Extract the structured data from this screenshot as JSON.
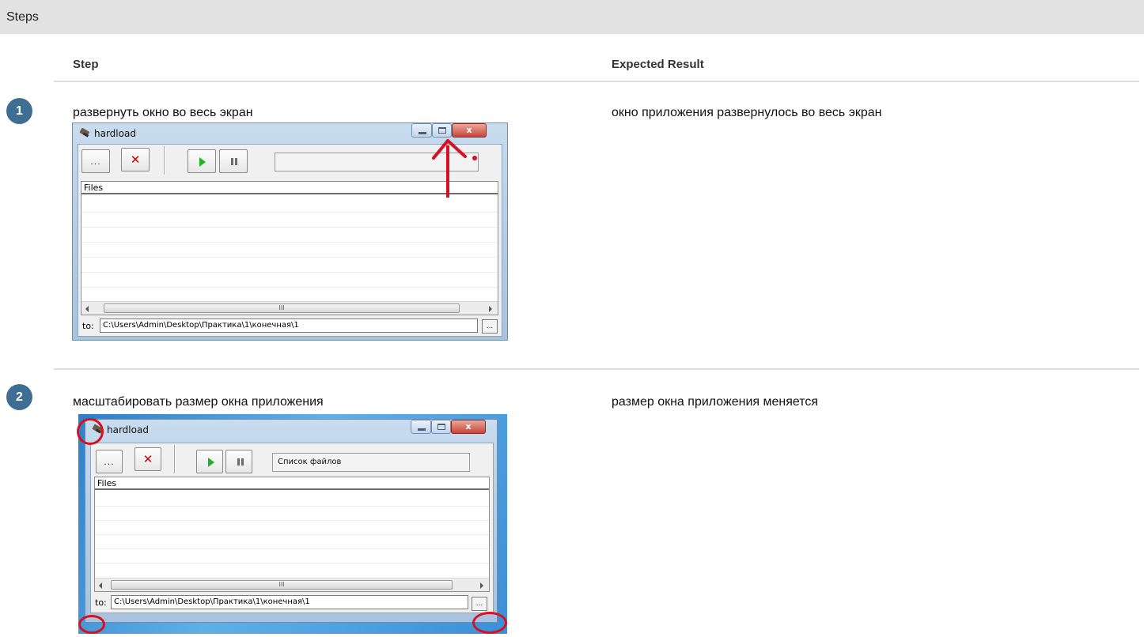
{
  "section": {
    "title": "Steps"
  },
  "columns": {
    "step": "Step",
    "expected": "Expected Result"
  },
  "steps": [
    {
      "number": "1",
      "action": "развернуть окно во весь экран",
      "expected": "окно приложения развернулось во весь экран",
      "window": {
        "title": "hardload",
        "browse_label": "...",
        "cancel_glyph": "✕",
        "close_glyph": "x",
        "status_text": "",
        "list_header": "Files",
        "scroll_mark": "III",
        "to_label": "to:",
        "path": "C:\\Users\\Admin\\Desktop\\Практика\\1\\конечная\\1",
        "path_browse_label": "..."
      }
    },
    {
      "number": "2",
      "action": "масштабировать размер окна приложения",
      "expected": "размер окна приложения меняется",
      "window": {
        "title": "hardload",
        "browse_label": "...",
        "cancel_glyph": "✕",
        "close_glyph": "x",
        "status_text": "Список файлов",
        "list_header": "Files",
        "scroll_mark": "III",
        "to_label": "to:",
        "path": "C:\\Users\\Admin\\Desktop\\Практика\\1\\конечная\\1",
        "path_browse_label": "..."
      }
    }
  ],
  "colors": {
    "header_bg": "#e2e2e2",
    "badge_bg": "#3e6e94",
    "annotation": "#d81020",
    "play": "#22b327",
    "cancel": "#d10000"
  }
}
